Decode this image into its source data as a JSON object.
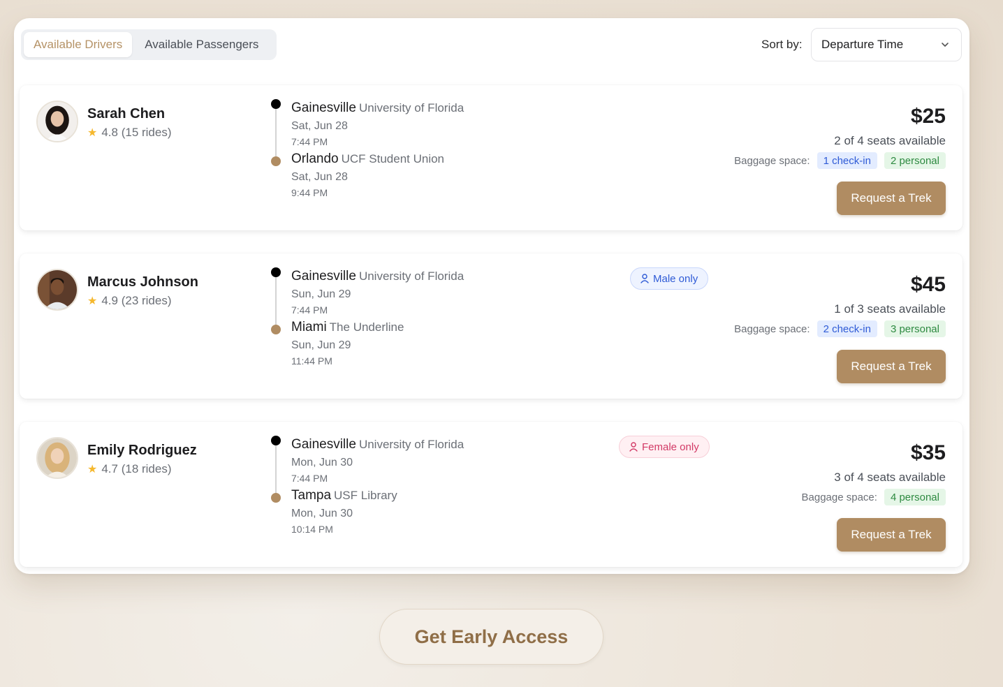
{
  "tabs": [
    {
      "label": "Available Drivers",
      "active": true
    },
    {
      "label": "Available Passengers",
      "active": false
    }
  ],
  "sort": {
    "label": "Sort by:",
    "value": "Departure Time"
  },
  "rides": [
    {
      "driver": "Sarah Chen",
      "rating": "4.8 (15 rides)",
      "from": {
        "city": "Gainesville",
        "place": "University of Florida",
        "date": "Sat, Jun 28",
        "time": "7:44 PM"
      },
      "to": {
        "city": "Orlando",
        "place": "UCF Student Union",
        "date": "Sat, Jun 28",
        "time": "9:44 PM"
      },
      "gender": "",
      "price": "$25",
      "seats": "2 of 4 seats available",
      "baggage_label": "Baggage space:",
      "checkin": "1 check-in",
      "personal": "2 personal",
      "button": "Request a Trek"
    },
    {
      "driver": "Marcus Johnson",
      "rating": "4.9 (23 rides)",
      "from": {
        "city": "Gainesville",
        "place": "University of Florida",
        "date": "Sun, Jun 29",
        "time": "7:44 PM"
      },
      "to": {
        "city": "Miami",
        "place": "The Underline",
        "date": "Sun, Jun 29",
        "time": "11:44 PM"
      },
      "gender": "Male only",
      "price": "$45",
      "seats": "1 of 3 seats available",
      "baggage_label": "Baggage space:",
      "checkin": "2 check-in",
      "personal": "3 personal",
      "button": "Request a Trek"
    },
    {
      "driver": "Emily Rodriguez",
      "rating": "4.7 (18 rides)",
      "from": {
        "city": "Gainesville",
        "place": "University of Florida",
        "date": "Mon, Jun 30",
        "time": "7:44 PM"
      },
      "to": {
        "city": "Tampa",
        "place": "USF Library",
        "date": "Mon, Jun 30",
        "time": "10:14 PM"
      },
      "gender": "Female only",
      "price": "$35",
      "seats": "3 of 4 seats available",
      "baggage_label": "Baggage space:",
      "checkin": "",
      "personal": "4 personal",
      "button": "Request a Trek"
    }
  ],
  "cta": "Get Early Access",
  "colors": {
    "accent": "#b08c62",
    "accent_text": "#b59266",
    "male": "#2f5bd6",
    "female": "#d23a66",
    "star": "#f5b82e"
  }
}
